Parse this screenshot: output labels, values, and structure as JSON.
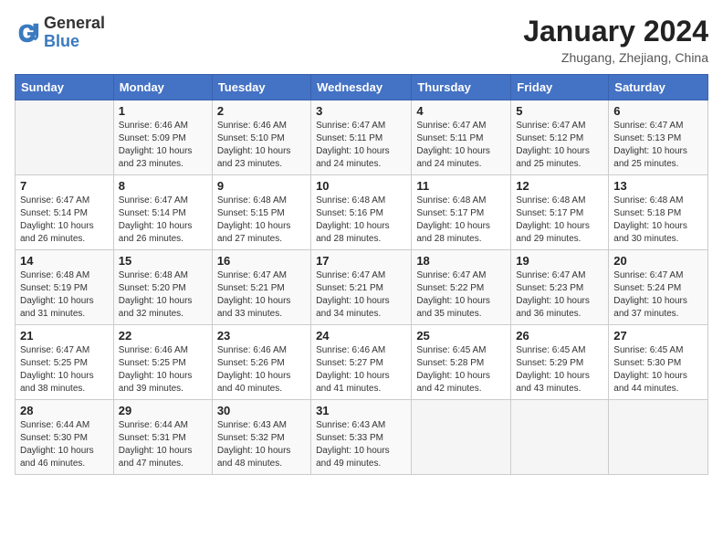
{
  "header": {
    "logo_general": "General",
    "logo_blue": "Blue",
    "month_year": "January 2024",
    "location": "Zhugang, Zhejiang, China"
  },
  "columns": [
    "Sunday",
    "Monday",
    "Tuesday",
    "Wednesday",
    "Thursday",
    "Friday",
    "Saturday"
  ],
  "weeks": [
    [
      {
        "day": "",
        "info": ""
      },
      {
        "day": "1",
        "info": "Sunrise: 6:46 AM\nSunset: 5:09 PM\nDaylight: 10 hours\nand 23 minutes."
      },
      {
        "day": "2",
        "info": "Sunrise: 6:46 AM\nSunset: 5:10 PM\nDaylight: 10 hours\nand 23 minutes."
      },
      {
        "day": "3",
        "info": "Sunrise: 6:47 AM\nSunset: 5:11 PM\nDaylight: 10 hours\nand 24 minutes."
      },
      {
        "day": "4",
        "info": "Sunrise: 6:47 AM\nSunset: 5:11 PM\nDaylight: 10 hours\nand 24 minutes."
      },
      {
        "day": "5",
        "info": "Sunrise: 6:47 AM\nSunset: 5:12 PM\nDaylight: 10 hours\nand 25 minutes."
      },
      {
        "day": "6",
        "info": "Sunrise: 6:47 AM\nSunset: 5:13 PM\nDaylight: 10 hours\nand 25 minutes."
      }
    ],
    [
      {
        "day": "7",
        "info": "Sunrise: 6:47 AM\nSunset: 5:14 PM\nDaylight: 10 hours\nand 26 minutes."
      },
      {
        "day": "8",
        "info": "Sunrise: 6:47 AM\nSunset: 5:14 PM\nDaylight: 10 hours\nand 26 minutes."
      },
      {
        "day": "9",
        "info": "Sunrise: 6:48 AM\nSunset: 5:15 PM\nDaylight: 10 hours\nand 27 minutes."
      },
      {
        "day": "10",
        "info": "Sunrise: 6:48 AM\nSunset: 5:16 PM\nDaylight: 10 hours\nand 28 minutes."
      },
      {
        "day": "11",
        "info": "Sunrise: 6:48 AM\nSunset: 5:17 PM\nDaylight: 10 hours\nand 28 minutes."
      },
      {
        "day": "12",
        "info": "Sunrise: 6:48 AM\nSunset: 5:17 PM\nDaylight: 10 hours\nand 29 minutes."
      },
      {
        "day": "13",
        "info": "Sunrise: 6:48 AM\nSunset: 5:18 PM\nDaylight: 10 hours\nand 30 minutes."
      }
    ],
    [
      {
        "day": "14",
        "info": "Sunrise: 6:48 AM\nSunset: 5:19 PM\nDaylight: 10 hours\nand 31 minutes."
      },
      {
        "day": "15",
        "info": "Sunrise: 6:48 AM\nSunset: 5:20 PM\nDaylight: 10 hours\nand 32 minutes."
      },
      {
        "day": "16",
        "info": "Sunrise: 6:47 AM\nSunset: 5:21 PM\nDaylight: 10 hours\nand 33 minutes."
      },
      {
        "day": "17",
        "info": "Sunrise: 6:47 AM\nSunset: 5:21 PM\nDaylight: 10 hours\nand 34 minutes."
      },
      {
        "day": "18",
        "info": "Sunrise: 6:47 AM\nSunset: 5:22 PM\nDaylight: 10 hours\nand 35 minutes."
      },
      {
        "day": "19",
        "info": "Sunrise: 6:47 AM\nSunset: 5:23 PM\nDaylight: 10 hours\nand 36 minutes."
      },
      {
        "day": "20",
        "info": "Sunrise: 6:47 AM\nSunset: 5:24 PM\nDaylight: 10 hours\nand 37 minutes."
      }
    ],
    [
      {
        "day": "21",
        "info": "Sunrise: 6:47 AM\nSunset: 5:25 PM\nDaylight: 10 hours\nand 38 minutes."
      },
      {
        "day": "22",
        "info": "Sunrise: 6:46 AM\nSunset: 5:25 PM\nDaylight: 10 hours\nand 39 minutes."
      },
      {
        "day": "23",
        "info": "Sunrise: 6:46 AM\nSunset: 5:26 PM\nDaylight: 10 hours\nand 40 minutes."
      },
      {
        "day": "24",
        "info": "Sunrise: 6:46 AM\nSunset: 5:27 PM\nDaylight: 10 hours\nand 41 minutes."
      },
      {
        "day": "25",
        "info": "Sunrise: 6:45 AM\nSunset: 5:28 PM\nDaylight: 10 hours\nand 42 minutes."
      },
      {
        "day": "26",
        "info": "Sunrise: 6:45 AM\nSunset: 5:29 PM\nDaylight: 10 hours\nand 43 minutes."
      },
      {
        "day": "27",
        "info": "Sunrise: 6:45 AM\nSunset: 5:30 PM\nDaylight: 10 hours\nand 44 minutes."
      }
    ],
    [
      {
        "day": "28",
        "info": "Sunrise: 6:44 AM\nSunset: 5:30 PM\nDaylight: 10 hours\nand 46 minutes."
      },
      {
        "day": "29",
        "info": "Sunrise: 6:44 AM\nSunset: 5:31 PM\nDaylight: 10 hours\nand 47 minutes."
      },
      {
        "day": "30",
        "info": "Sunrise: 6:43 AM\nSunset: 5:32 PM\nDaylight: 10 hours\nand 48 minutes."
      },
      {
        "day": "31",
        "info": "Sunrise: 6:43 AM\nSunset: 5:33 PM\nDaylight: 10 hours\nand 49 minutes."
      },
      {
        "day": "",
        "info": ""
      },
      {
        "day": "",
        "info": ""
      },
      {
        "day": "",
        "info": ""
      }
    ]
  ]
}
